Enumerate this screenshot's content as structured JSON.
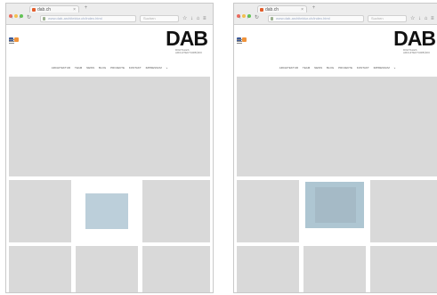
{
  "browser": {
    "tab_title": "dab.ch",
    "tab_close": "×",
    "new_tab": "+",
    "url": "www.dab-architektur.ch/index.html",
    "search_placeholder": "Suchen",
    "toolbar_icons": "☆ ↓ ⌂ ≡",
    "nav": {
      "back": "‹",
      "forward": "›",
      "reload": "↻"
    }
  },
  "site": {
    "logo_text": "DAB",
    "logo_tagline": "DIGITALES ARCHITEKTURBÜRO",
    "menu": [
      "ARCHITEKTUR",
      "TEAM",
      "NEWS",
      "BLOG",
      "PROJEKTE",
      "KONTAKT",
      "IMPRESSUM"
    ],
    "menu_more": "»"
  },
  "colors": {
    "placeholder_grey": "#d9d9d9",
    "image_placeholder": "#bccfda",
    "social_facebook": "#3b5998",
    "social_rss": "#f0933a"
  }
}
